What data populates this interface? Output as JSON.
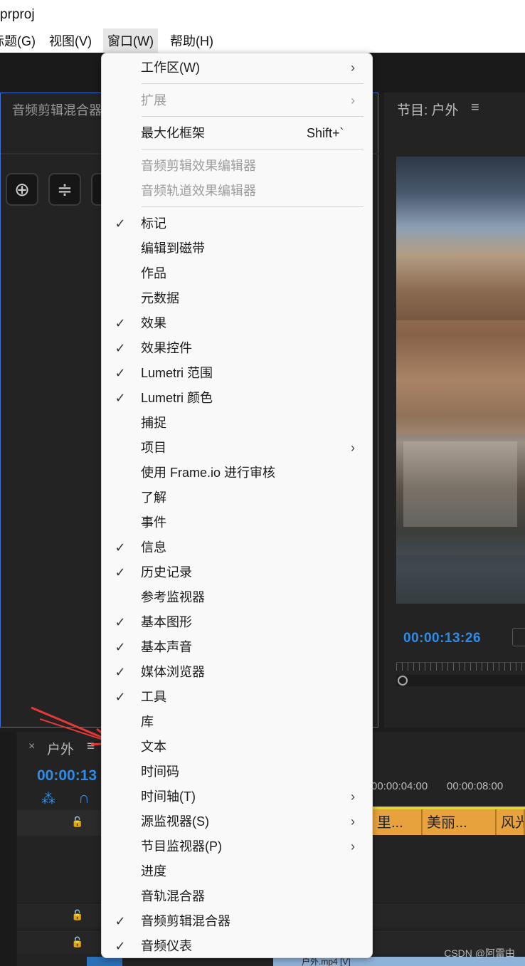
{
  "window": {
    "title": "prproj"
  },
  "menubar": {
    "items": [
      {
        "label": "标题(G)"
      },
      {
        "label": "视图(V)"
      },
      {
        "label": "窗口(W)"
      },
      {
        "label": "帮助(H)"
      }
    ]
  },
  "left_panel": {
    "tab_label": "音频剪辑混合器"
  },
  "program_monitor": {
    "title": "节目: 户外",
    "timecode": "00:00:13:26"
  },
  "timeline": {
    "sequence_name": "户外",
    "timecode": "00:00:13",
    "ruler_labels": [
      "00:00:04:00",
      "00:00:08:00"
    ],
    "clips": [
      "里...",
      "美丽...",
      "风光"
    ],
    "video_clip": "户外.mp4 [V]"
  },
  "window_menu": {
    "items": [
      {
        "label": "工作区(W)",
        "checked": false,
        "submenu": true,
        "disabled": false
      },
      {
        "label": "扩展",
        "checked": false,
        "submenu": true,
        "disabled": true
      },
      {
        "label": "最大化框架",
        "checked": false,
        "submenu": false,
        "disabled": false,
        "shortcut": "Shift+`"
      },
      {
        "label": "音频剪辑效果编辑器",
        "checked": false,
        "submenu": false,
        "disabled": true
      },
      {
        "label": "音频轨道效果编辑器",
        "checked": false,
        "submenu": false,
        "disabled": true
      },
      {
        "label": "标记",
        "checked": true
      },
      {
        "label": "编辑到磁带",
        "checked": false
      },
      {
        "label": "作品",
        "checked": false
      },
      {
        "label": "元数据",
        "checked": false
      },
      {
        "label": "效果",
        "checked": true
      },
      {
        "label": "效果控件",
        "checked": true
      },
      {
        "label": "Lumetri 范围",
        "checked": true
      },
      {
        "label": "Lumetri 颜色",
        "checked": true
      },
      {
        "label": "捕捉",
        "checked": false
      },
      {
        "label": "项目",
        "checked": false,
        "submenu": true
      },
      {
        "label": "使用 Frame.io 进行审核",
        "checked": false
      },
      {
        "label": "了解",
        "checked": false
      },
      {
        "label": "事件",
        "checked": false
      },
      {
        "label": "信息",
        "checked": true
      },
      {
        "label": "历史记录",
        "checked": true
      },
      {
        "label": "参考监视器",
        "checked": false
      },
      {
        "label": "基本图形",
        "checked": true
      },
      {
        "label": "基本声音",
        "checked": true
      },
      {
        "label": "媒体浏览器",
        "checked": true
      },
      {
        "label": "工具",
        "checked": true
      },
      {
        "label": "库",
        "checked": false
      },
      {
        "label": "文本",
        "checked": false
      },
      {
        "label": "时间码",
        "checked": false
      },
      {
        "label": "时间轴(T)",
        "checked": false,
        "submenu": true
      },
      {
        "label": "源监视器(S)",
        "checked": false,
        "submenu": true
      },
      {
        "label": "节目监视器(P)",
        "checked": false,
        "submenu": true
      },
      {
        "label": "进度",
        "checked": false
      },
      {
        "label": "音轨混合器",
        "checked": false
      },
      {
        "label": "音频剪辑混合器",
        "checked": true
      },
      {
        "label": "音频仪表",
        "checked": true
      }
    ]
  },
  "watermark": "CSDN @阿雷由",
  "colors": {
    "timecode_blue": "#2d8ceb",
    "clip_orange": "#e8a23d",
    "annotation_red": "#e53935"
  }
}
